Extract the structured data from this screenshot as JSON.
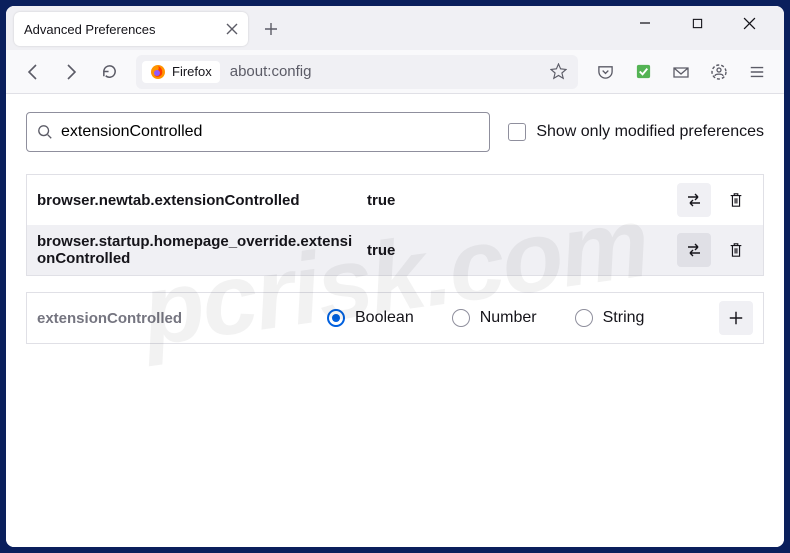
{
  "window": {
    "tab_title": "Advanced Preferences",
    "identity_label": "Firefox",
    "url": "about:config"
  },
  "search": {
    "value": "extensionControlled",
    "checkbox_label": "Show only modified preferences"
  },
  "prefs": [
    {
      "name": "browser.newtab.extensionControlled",
      "value": "true"
    },
    {
      "name": "browser.startup.homepage_override.extensionControlled",
      "value": "true"
    }
  ],
  "new_pref": {
    "name": "extensionControlled",
    "types": [
      "Boolean",
      "Number",
      "String"
    ],
    "selected": "Boolean"
  }
}
